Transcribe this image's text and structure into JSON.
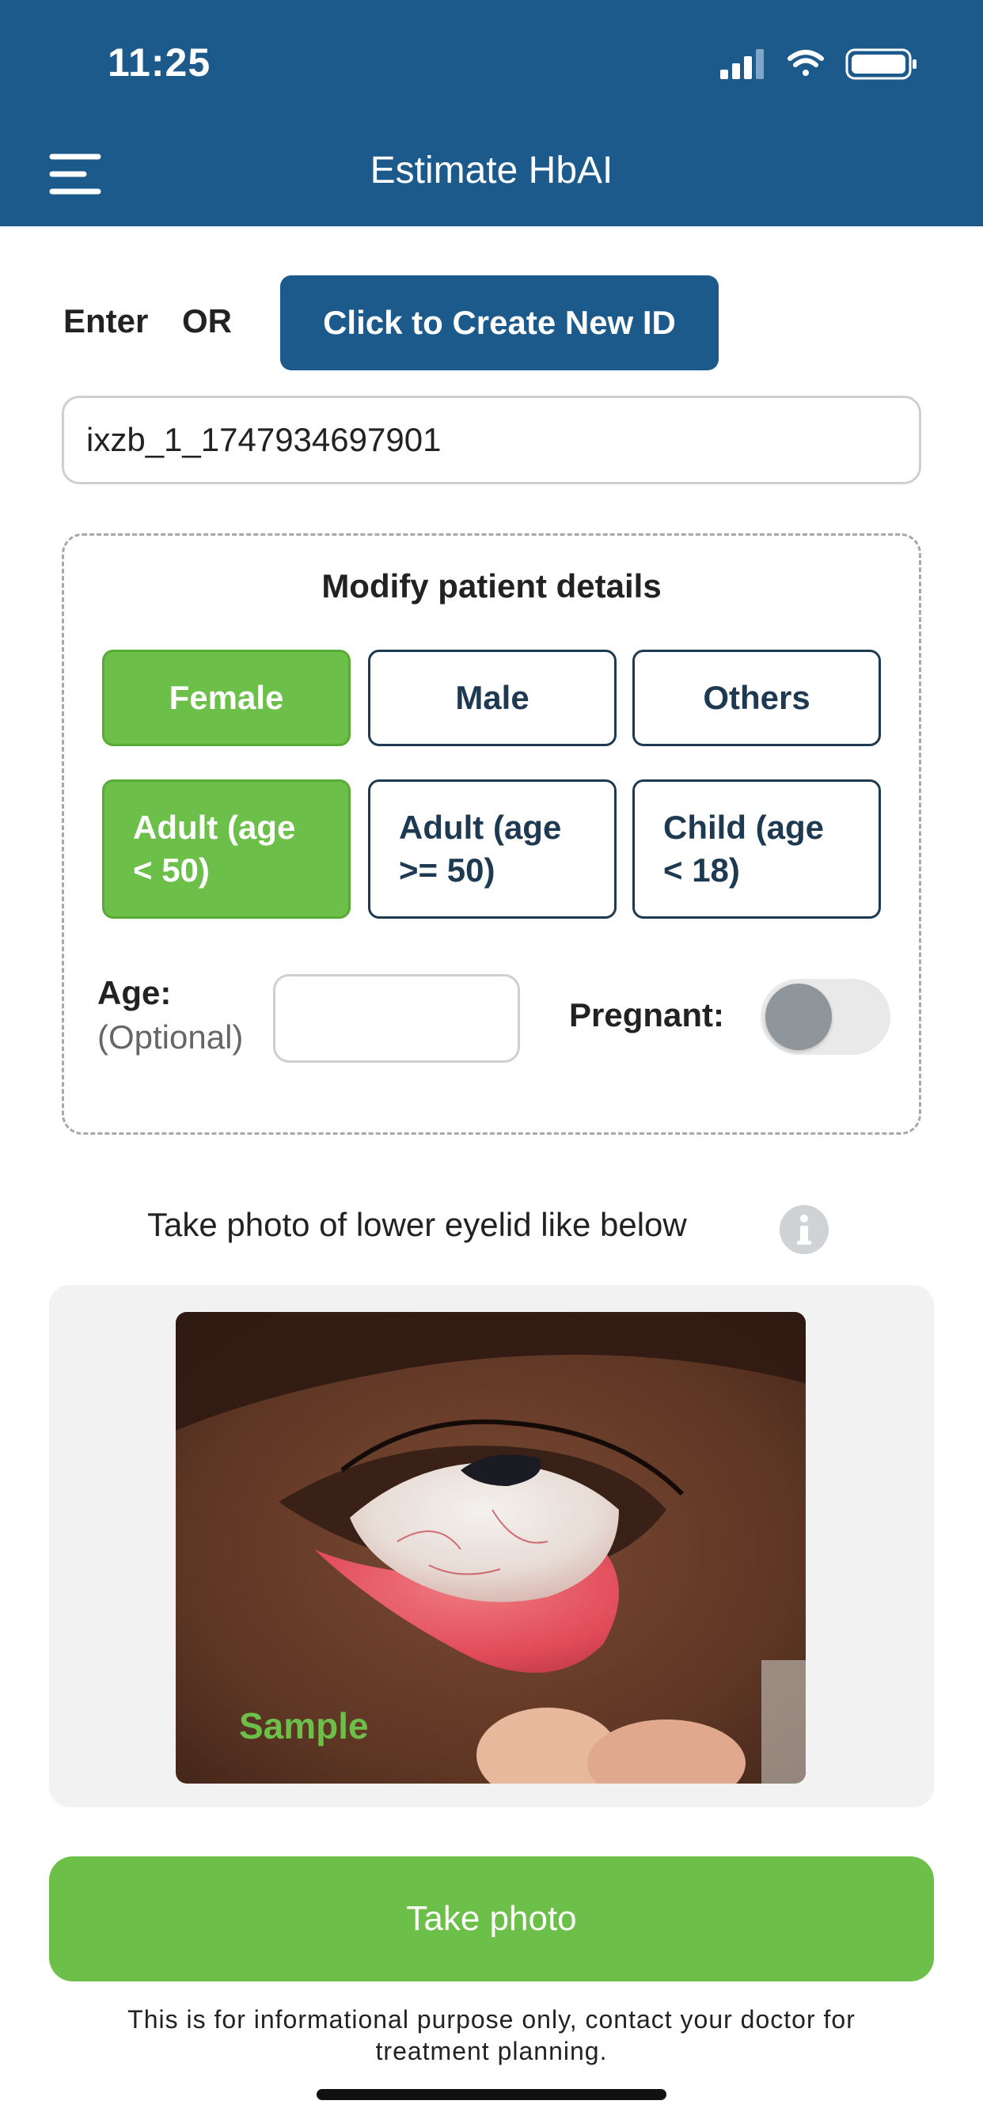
{
  "status_bar": {
    "time": "11:25",
    "icons": [
      "signal-icon",
      "wifi-icon",
      "battery-icon"
    ]
  },
  "header": {
    "title": "Estimate HbAI",
    "menu_icon": "menu-icon",
    "background_color": "#1d5a8c"
  },
  "id_section": {
    "enter_label": "Enter",
    "or_label": "OR",
    "create_button_label": "Click to Create New ID",
    "id_value": "ixzb_1_1747934697901"
  },
  "patient_details": {
    "title": "Modify patient details",
    "gender_options": [
      {
        "label": "Female",
        "selected": true
      },
      {
        "label": "Male",
        "selected": false
      },
      {
        "label": "Others",
        "selected": false
      }
    ],
    "age_group_options": [
      {
        "label": "Adult (age < 50)",
        "line1": "Adult (age",
        "line2": "< 50)",
        "selected": true
      },
      {
        "label": "Adult (age >= 50)",
        "line1": "Adult (age",
        "line2": ">= 50)",
        "selected": false
      },
      {
        "label": "Child (age < 18)",
        "line1": "Child (age",
        "line2": "< 18)",
        "selected": false
      }
    ],
    "age_label": "Age:",
    "age_optional_label": "(Optional)",
    "age_value": "",
    "pregnant_label": "Pregnant:",
    "pregnant_on": false
  },
  "photo_section": {
    "hint": "Take photo of lower eyelid like below",
    "info_icon": "info-icon",
    "sample_label": "Sample",
    "take_photo_label": "Take photo"
  },
  "disclaimer": {
    "line1": "This is for informational purpose only, contact your doctor for",
    "line2": "treatment planning."
  },
  "colors": {
    "primary_blue": "#1d5a8c",
    "accent_green": "#6cbf48",
    "unselected_border": "#1e3a52"
  }
}
